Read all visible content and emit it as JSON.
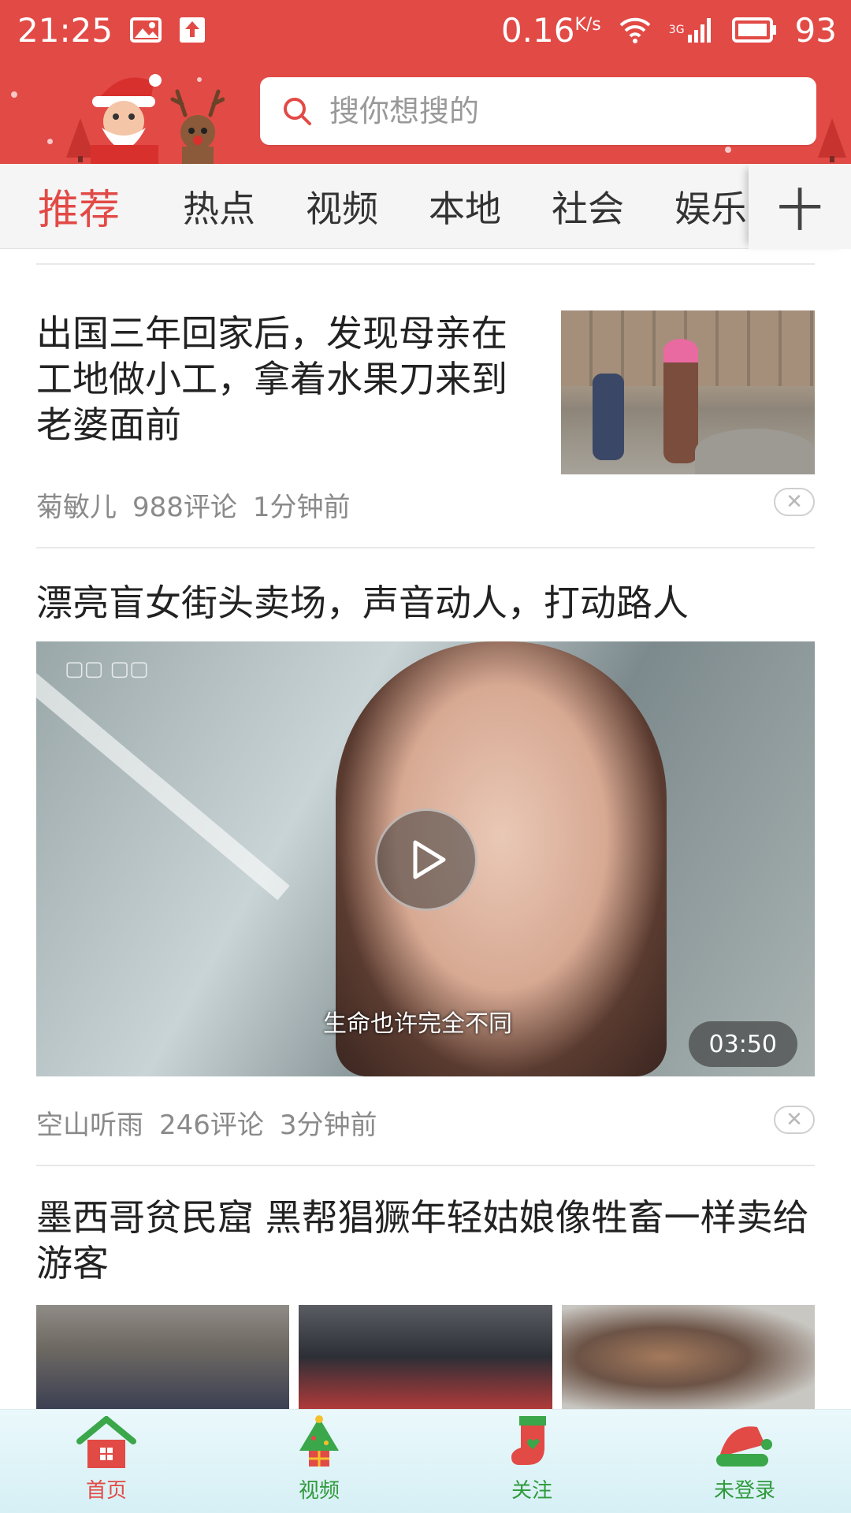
{
  "status_bar": {
    "time": "21:25",
    "network_speed": "0.16",
    "speed_unit": "K/s",
    "network_type": "3G",
    "battery": "93"
  },
  "search": {
    "placeholder": "搜你想搜的"
  },
  "tabs": {
    "items": [
      "推荐",
      "热点",
      "视频",
      "本地",
      "社会",
      "娱乐"
    ],
    "active_index": 0,
    "add_label": "十"
  },
  "feed": {
    "items": [
      {
        "title": "出国三年回家后，发现母亲在工地做小工，拿着水果刀来到老婆面前",
        "author": "菊敏儿",
        "comments": "988评论",
        "time": "1分钟前"
      },
      {
        "title": "漂亮盲女街头卖场，声音动人，打动路人",
        "video_subtitle": "生命也许完全不同",
        "duration": "03:50",
        "author": "空山听雨",
        "comments": "246评论",
        "time": "3分钟前"
      },
      {
        "title": "墨西哥贫民窟 黑帮猖獗年轻姑娘像牲畜一样卖给游客"
      }
    ]
  },
  "bottom_nav": {
    "items": [
      {
        "label": "首页",
        "icon": "home-icon",
        "color": "#e24a46"
      },
      {
        "label": "视频",
        "icon": "christmas-tree-icon",
        "color": "#2f9a3b"
      },
      {
        "label": "关注",
        "icon": "stocking-icon",
        "color": "#2f9a3b"
      },
      {
        "label": "未登录",
        "icon": "santa-hat-icon",
        "color": "#2f9a3b"
      }
    ]
  },
  "colors": {
    "brand": "#e24a46",
    "nav_green": "#2f9a3b"
  }
}
